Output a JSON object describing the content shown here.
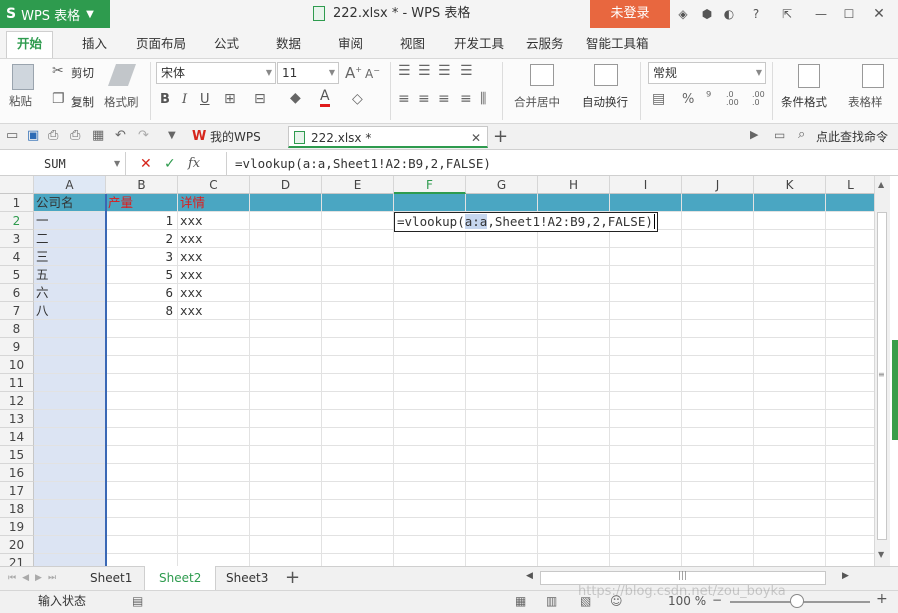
{
  "titlebar": {
    "app_logo": "S",
    "app_name": "WPS 表格",
    "doc_title": "222.xlsx * - WPS 表格",
    "login": "未登录",
    "help": "?"
  },
  "menu": {
    "tabs": [
      "开始",
      "插入",
      "页面布局",
      "公式",
      "数据",
      "审阅",
      "视图",
      "开发工具",
      "云服务",
      "智能工具箱"
    ],
    "active": "开始"
  },
  "ribbon": {
    "paste": "粘贴",
    "cut": "剪切",
    "copy": "复制",
    "format_painter": "格式刷",
    "font_name": "宋体",
    "font_size": "11",
    "merge_center": "合并居中",
    "wrap_text": "自动换行",
    "number_format": "常规",
    "percent": "%",
    "comma": "⁹",
    "conditional_format": "条件格式",
    "table_style": "表格样",
    "bold": "B",
    "italic": "I",
    "underline": "U",
    "font_color_letter": "A"
  },
  "quickbar": {
    "home_tab": "我的WPS",
    "doc_tab": "222.xlsx *",
    "search": "点此查找命令"
  },
  "formulabar": {
    "namebox": "SUM",
    "fx": "fx",
    "formula": "=vlookup(a:a,Sheet1!A2:B9,2,FALSE)"
  },
  "grid": {
    "columns": [
      "A",
      "B",
      "C",
      "D",
      "E",
      "F",
      "G",
      "H",
      "I",
      "J",
      "K",
      "L"
    ],
    "rows": [
      "1",
      "2",
      "3",
      "4",
      "5",
      "6",
      "7",
      "8",
      "9",
      "10",
      "11",
      "12",
      "13",
      "14",
      "15",
      "16",
      "17",
      "18",
      "19",
      "20",
      "21"
    ],
    "header_row": {
      "A": "公司名",
      "B": "产量",
      "C": "详情"
    },
    "data": [
      {
        "A": "一",
        "B": "1",
        "C": "xxx"
      },
      {
        "A": "二",
        "B": "2",
        "C": "xxx"
      },
      {
        "A": "三",
        "B": "3",
        "C": "xxx"
      },
      {
        "A": "五",
        "B": "5",
        "C": "xxx"
      },
      {
        "A": "六",
        "B": "6",
        "C": "xxx"
      },
      {
        "A": "八",
        "B": "8",
        "C": "xxx"
      }
    ],
    "edit_cell": {
      "prefix": "=vlookup(",
      "highlight": "a:a",
      "suffix": ",Sheet1!A2:B9,2,FALSE)"
    }
  },
  "sheets": {
    "tabs": [
      "Sheet1",
      "Sheet2",
      "Sheet3"
    ],
    "active": "Sheet2",
    "add": "+"
  },
  "status": {
    "mode": "输入状态",
    "zoom": "100 %",
    "watermark": "https://blog.csdn.net/zou_boyka"
  },
  "colors": {
    "accent": "#2e9b4e",
    "login": "#e8673f",
    "header_fill": "#4aa6c2",
    "column_select": "#dce4f3",
    "red_text": "#e01b1b"
  }
}
